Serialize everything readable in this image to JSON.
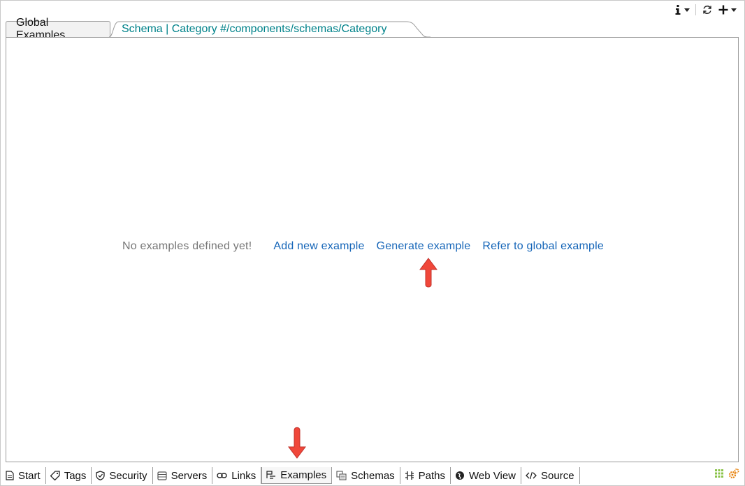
{
  "toolbar": {
    "info_icon": "info-icon",
    "refresh_icon": "refresh-icon",
    "add_icon": "plus-icon"
  },
  "editor_tabs": [
    {
      "label": "Global Examples"
    },
    {
      "label": "Schema | Category #/components/schemas/Category"
    }
  ],
  "content": {
    "empty_message": "No examples defined yet!",
    "links": [
      "Add new example",
      "Generate example",
      "Refer to global example"
    ]
  },
  "bottom_tabs": [
    {
      "label": "Start",
      "icon": "document-icon"
    },
    {
      "label": "Tags",
      "icon": "tag-icon"
    },
    {
      "label": "Security",
      "icon": "shield-icon"
    },
    {
      "label": "Servers",
      "icon": "server-icon"
    },
    {
      "label": "Links",
      "icon": "link-icon"
    },
    {
      "label": "Examples",
      "icon": "examples-icon",
      "active": true
    },
    {
      "label": "Schemas",
      "icon": "schemas-icon"
    },
    {
      "label": "Paths",
      "icon": "paths-icon"
    },
    {
      "label": "Web View",
      "icon": "globe-icon"
    },
    {
      "label": "Source",
      "icon": "code-icon"
    }
  ],
  "colors": {
    "link": "#1565b8",
    "schema_tab": "#00828a",
    "arrow": "#f0473a"
  }
}
